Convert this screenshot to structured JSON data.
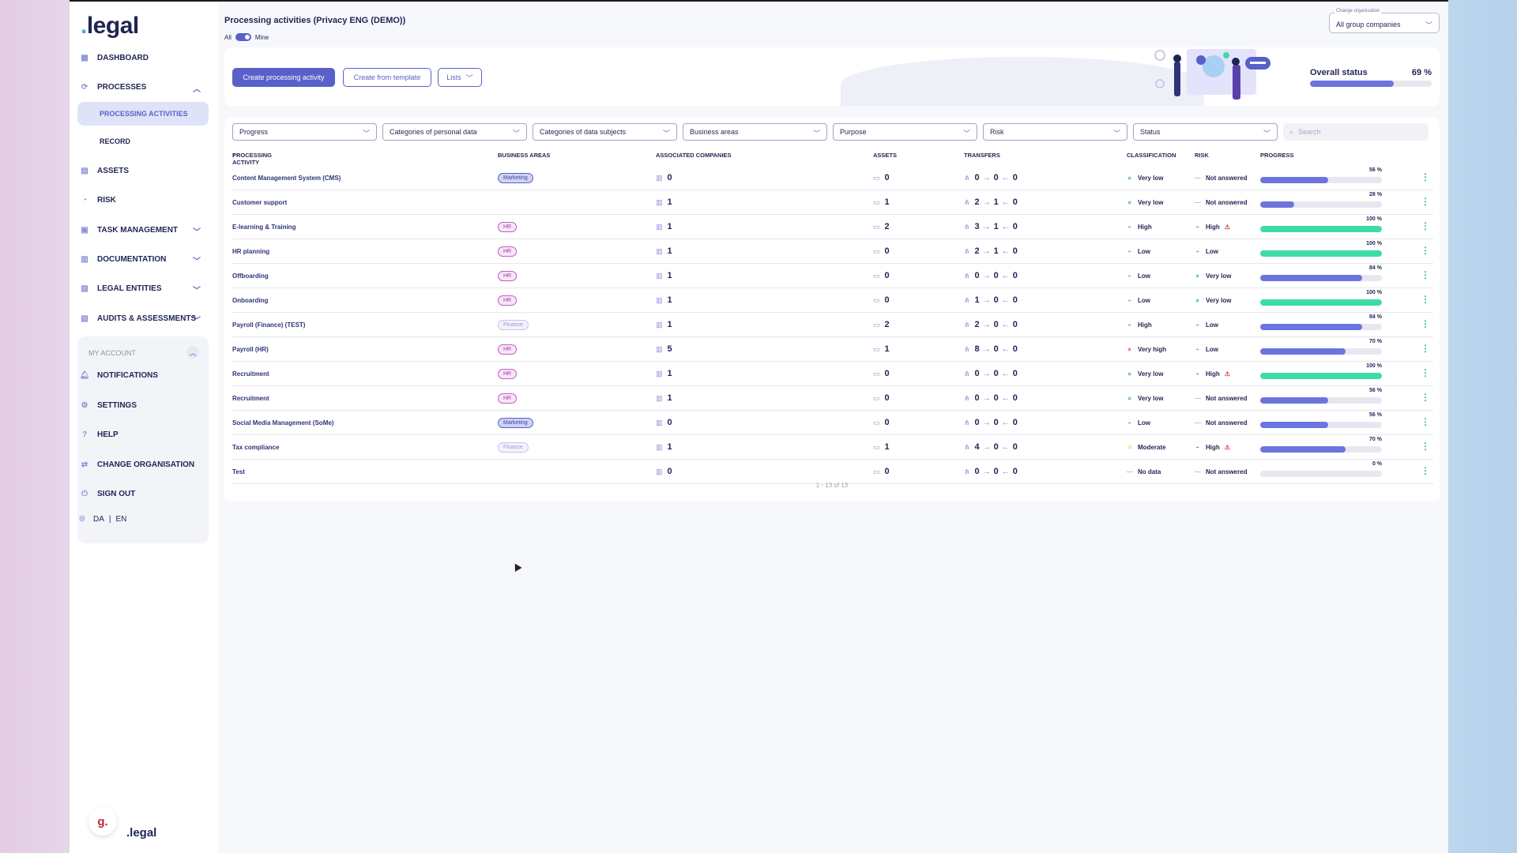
{
  "brand": {
    "logo_dot": ".",
    "logo_text": "legal",
    "footer_logo": "g.",
    "footer_text": ".legal"
  },
  "sidebar": {
    "items": [
      {
        "label": "Dashboard",
        "icon": "dashboard-icon"
      },
      {
        "label": "Processes",
        "icon": "processes-icon",
        "expanded": true
      },
      {
        "label": "Assets",
        "icon": "assets-icon"
      },
      {
        "label": "Risk",
        "icon": "risk-icon"
      },
      {
        "label": "Task management",
        "icon": "task-icon"
      },
      {
        "label": "Documentation",
        "icon": "documentation-icon"
      },
      {
        "label": "Legal entities",
        "icon": "legal-entities-icon"
      },
      {
        "label": "Audits & assessments",
        "icon": "audits-icon"
      }
    ],
    "sub_items": [
      "Processing activities",
      "Record"
    ],
    "account_title": "My account",
    "account_items": [
      "Notifications",
      "Settings",
      "Help",
      "Change organisation",
      "Sign out"
    ],
    "lang": {
      "da": "DA",
      "sep": "|",
      "en": "EN"
    }
  },
  "header": {
    "title": "Processing activities (Privacy ENG (DEMO))",
    "toggle_all": "All",
    "toggle_mine": "Mine",
    "org_label": "Change organisation",
    "org_value": "All group companies"
  },
  "banner": {
    "create_btn": "Create processing activity",
    "template_btn": "Create from template",
    "lists_btn": "Lists",
    "overall_label": "Overall status",
    "overall_pct": "69 %",
    "overall_value": 0.69
  },
  "filters": [
    "Progress",
    "Categories of personal data",
    "Categories of data subjects",
    "Business areas",
    "Purpose",
    "Risk",
    "Status"
  ],
  "search_placeholder": "Search",
  "columns": [
    "Processing activity",
    "Business areas",
    "Associated companies",
    "Assets",
    "Transfers",
    "Classification",
    "Risk",
    "Progress"
  ],
  "rows": [
    {
      "name": "Content Management System (CMS)",
      "area": "Marketing",
      "companies": "0",
      "assets": "0",
      "t1": "0",
      "t2": "0",
      "t3": "0",
      "class": "Very low",
      "risk": "Not answered",
      "progress": "56 %",
      "pv": 0.56
    },
    {
      "name": "Customer support",
      "area": "",
      "companies": "1",
      "assets": "1",
      "t1": "2",
      "t2": "1",
      "t3": "0",
      "class": "Very low",
      "risk": "Not answered",
      "progress": "28 %",
      "pv": 0.28
    },
    {
      "name": "E-learning & Training",
      "area": "HR",
      "companies": "1",
      "assets": "2",
      "t1": "3",
      "t2": "1",
      "t3": "0",
      "class": "High",
      "risk": "High",
      "progress": "100 %",
      "pv": 1.0
    },
    {
      "name": "HR planning",
      "area": "HR",
      "companies": "1",
      "assets": "0",
      "t1": "2",
      "t2": "1",
      "t3": "0",
      "class": "Low",
      "risk": "Low",
      "progress": "100 %",
      "pv": 1.0
    },
    {
      "name": "Offboarding",
      "area": "HR",
      "companies": "1",
      "assets": "0",
      "t1": "0",
      "t2": "0",
      "t3": "0",
      "class": "Low",
      "risk": "Very low",
      "progress": "84 %",
      "pv": 0.84
    },
    {
      "name": "Onboarding",
      "area": "HR",
      "companies": "1",
      "assets": "0",
      "t1": "1",
      "t2": "0",
      "t3": "0",
      "class": "Low",
      "risk": "Very low",
      "progress": "100 %",
      "pv": 1.0
    },
    {
      "name": "Payroll (Finance) (TEST)",
      "area": "Finance",
      "companies": "1",
      "assets": "2",
      "t1": "2",
      "t2": "0",
      "t3": "0",
      "class": "High",
      "risk": "Low",
      "progress": "84 %",
      "pv": 0.84
    },
    {
      "name": "Payroll (HR)",
      "area": "HR",
      "companies": "5",
      "assets": "1",
      "t1": "8",
      "t2": "0",
      "t3": "0",
      "class": "Very high",
      "risk": "Low",
      "progress": "70 %",
      "pv": 0.7
    },
    {
      "name": "Recruitment",
      "area": "HR",
      "companies": "1",
      "assets": "0",
      "t1": "0",
      "t2": "0",
      "t3": "0",
      "class": "Very low",
      "risk": "High",
      "progress": "100 %",
      "pv": 1.0
    },
    {
      "name": "Recruitment",
      "area": "HR",
      "companies": "1",
      "assets": "0",
      "t1": "0",
      "t2": "0",
      "t3": "0",
      "class": "Very low",
      "risk": "Not answered",
      "progress": "56 %",
      "pv": 0.56
    },
    {
      "name": "Social Media Management (SoMe)",
      "area": "Marketing",
      "companies": "0",
      "assets": "0",
      "t1": "0",
      "t2": "0",
      "t3": "0",
      "class": "Low",
      "risk": "Not answered",
      "progress": "56 %",
      "pv": 0.56
    },
    {
      "name": "Tax compliance",
      "area": "Finance",
      "companies": "1",
      "assets": "1",
      "t1": "4",
      "t2": "0",
      "t3": "0",
      "class": "Moderate",
      "risk": "High",
      "progress": "70 %",
      "pv": 0.7
    },
    {
      "name": "Test",
      "area": "",
      "companies": "0",
      "assets": "0",
      "t1": "0",
      "t2": "0",
      "t3": "0",
      "class": "No data",
      "risk": "Not answered",
      "progress": "0 %",
      "pv": 0.0
    }
  ],
  "pager": "1 - 13 of 13",
  "colors": {
    "accent": "#5761c9",
    "complete": "#3ddba6",
    "progress": "#6c74dd",
    "high": "#d9364f",
    "low": "#2aa881",
    "moderate": "#e4c42a"
  }
}
